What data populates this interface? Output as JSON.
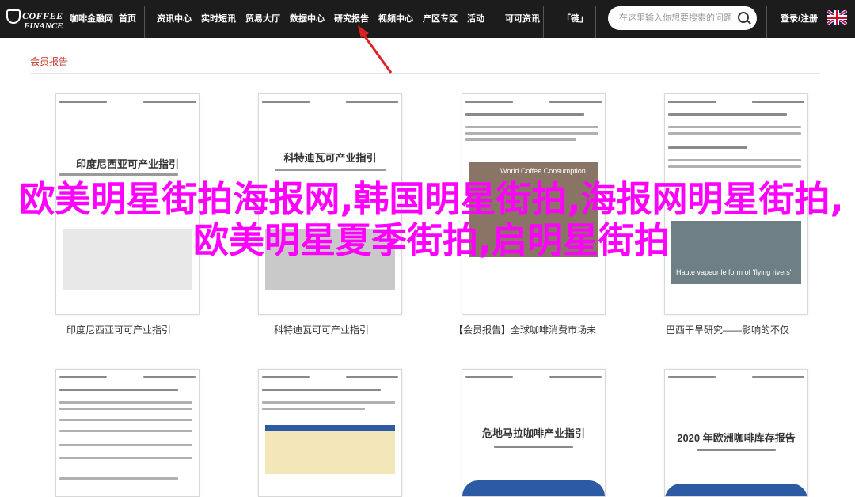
{
  "nav": {
    "logo_line1": "COFFEE",
    "logo_line2": "FINANCE",
    "items": [
      "咖啡金融网",
      "首页",
      "资讯中心",
      "实时短讯",
      "贸易大厅",
      "数据中心",
      "研究报告",
      "视频中心",
      "产区专区",
      "活动",
      "可可资讯",
      "「链」"
    ],
    "search_placeholder": "在这里输入你想要搜索的问题",
    "login": "登录/注册",
    "accent": "#e02020"
  },
  "section": {
    "title": "会员报告"
  },
  "cards_row1": [
    {
      "doc_title": "印度尼西亚可产业指引",
      "caption": "印度尼西亚可可产业指引"
    },
    {
      "doc_title": "科特迪瓦可产业指引",
      "caption": "科特迪瓦可可产业指引"
    },
    {
      "doc_title": "",
      "image_text": "World Coffee Consumption",
      "caption": "【会员报告】全球咖啡消费市场未"
    },
    {
      "doc_title": "",
      "image_text": "Haute vapeur le form of 'flying rivers'",
      "caption": "巴西干旱研究——影响的不仅"
    }
  ],
  "cards_row2": [
    {
      "doc_title": ""
    },
    {
      "doc_title": ""
    },
    {
      "doc_title": "危地马拉咖啡产业指引"
    },
    {
      "doc_title": "2020 年欧洲咖啡库存报告"
    }
  ],
  "overlay_text": "欧美明星街拍海报网,韩国明星街拍,海报网明星街拍,欧美明星夏季街拍,启明星街拍"
}
